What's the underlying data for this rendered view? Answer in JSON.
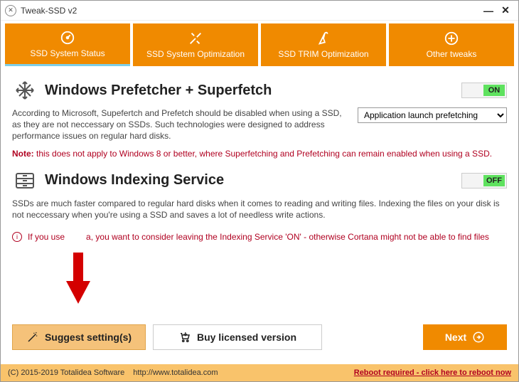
{
  "window": {
    "title": "Tweak-SSD v2"
  },
  "tabs": [
    {
      "label": "SSD System Status"
    },
    {
      "label": "SSD System Optimization"
    },
    {
      "label": "SSD TRIM Optimization"
    },
    {
      "label": "Other tweaks"
    }
  ],
  "section1": {
    "title": "Windows Prefetcher + Superfetch",
    "toggle": "ON",
    "desc": "According to Microsoft, Supefertch and Prefetch should be disabled when using a SSD, as they are not neccessary on SSDs. Such technologies were designed to address performance issues on regular hard disks.",
    "dropdown": "Application launch prefetching",
    "note_label": "Note:",
    "note": "this does not apply to Windows 8 or better, where Superfetching and Prefetching can remain enabled when using a SSD."
  },
  "section2": {
    "title": "Windows Indexing Service",
    "toggle": "OFF",
    "desc": "SSDs are much faster compared to regular hard disks when it comes to reading and writing files. Indexing the files on your disk is not neccessary when you're using a SSD and saves a lot of needless write actions."
  },
  "info": {
    "prefix": "If you use",
    "suffix": "a, you want to consider leaving the Indexing Service 'ON' - otherwise Cortana might not be able to find files"
  },
  "buttons": {
    "suggest": "Suggest setting(s)",
    "buy": "Buy licensed version",
    "next": "Next"
  },
  "status": {
    "copyright": "(C) 2015-2019 Totalidea Software",
    "url": "http://www.totalidea.com",
    "reboot": "Reboot required - click here to reboot now"
  }
}
